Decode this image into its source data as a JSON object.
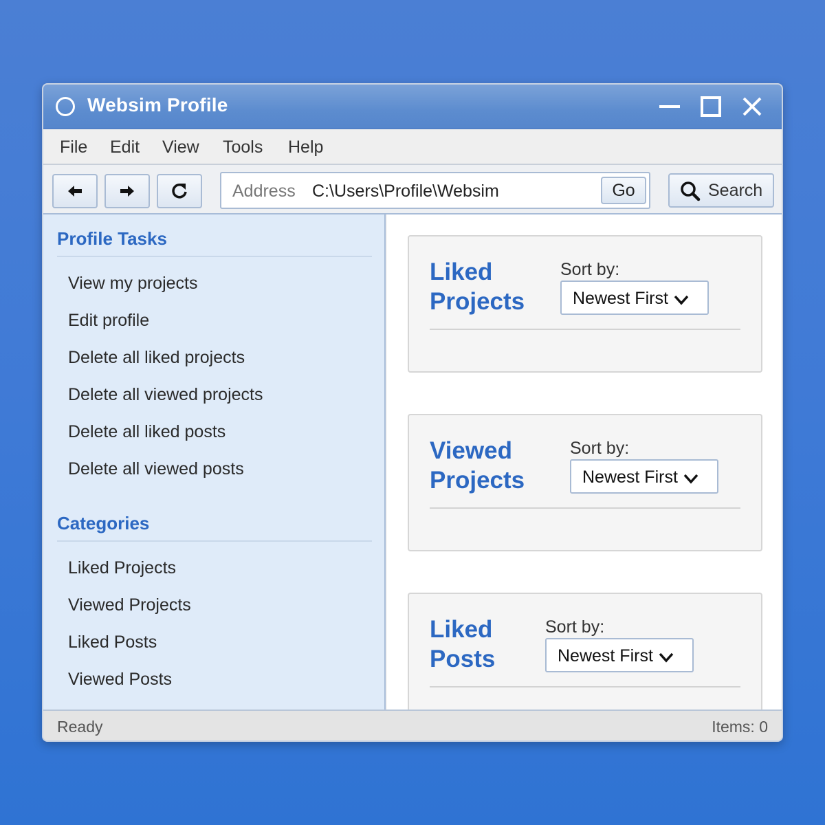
{
  "window": {
    "title": "Websim Profile",
    "title_icon": "circle-icon"
  },
  "menu": {
    "items": [
      "File",
      "Edit",
      "View",
      "Tools",
      "Help"
    ]
  },
  "toolbar": {
    "back_icon": "arrow-left-icon",
    "forward_icon": "arrow-right-icon",
    "refresh_icon": "refresh-icon",
    "address_label": "Address",
    "address_value": "C:\\Users\\Profile\\Websim",
    "go_label": "Go",
    "search_label": "Search",
    "search_icon": "magnifier-icon"
  },
  "sidebar": {
    "tasks_heading": "Profile Tasks",
    "tasks": [
      "View my projects",
      "Edit profile",
      "Delete all liked projects",
      "Delete all viewed projects",
      "Delete all liked posts",
      "Delete all viewed posts"
    ],
    "categories_heading": "Categories",
    "categories": [
      "Liked Projects",
      "Viewed Projects",
      "Liked Posts",
      "Viewed Posts"
    ]
  },
  "main": {
    "sections": [
      {
        "title_line1": "Liked",
        "title_line2": "Projects",
        "sort_label": "Sort by:",
        "sort_value": "Newest First"
      },
      {
        "title_line1": "Viewed",
        "title_line2": "Projects",
        "sort_label": "Sort by:",
        "sort_value": "Newest First"
      },
      {
        "title_line1": "Liked",
        "title_line2": "Posts",
        "sort_label": "Sort by:",
        "sort_value": "Newest First"
      }
    ]
  },
  "status": {
    "left": "Ready",
    "right": "Items: 0"
  },
  "colors": {
    "accent": "#2c68c2",
    "titlebar": "#5c8ccf",
    "sidebar_bg": "#dfebf9",
    "background": "#3f7ad6"
  }
}
